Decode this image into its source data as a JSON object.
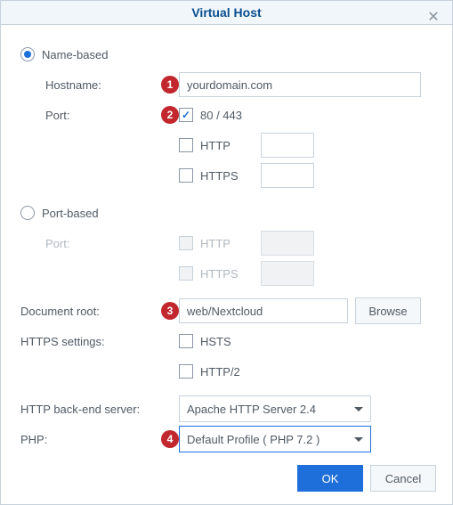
{
  "dialog": {
    "title": "Virtual Host"
  },
  "radio": {
    "name_based": "Name-based",
    "port_based": "Port-based"
  },
  "labels": {
    "hostname": "Hostname:",
    "port": "Port:",
    "docroot": "Document root:",
    "https_settings": "HTTPS settings:",
    "backend": "HTTP back-end server:",
    "php": "PHP:"
  },
  "fields": {
    "hostname_value": "yourdomain.com",
    "port_any_label": "80 / 443",
    "http_label": "HTTP",
    "https_label": "HTTPS",
    "docroot_value": "web/Nextcloud",
    "browse_btn": "Browse",
    "hsts_label": "HSTS",
    "http2_label": "HTTP/2",
    "backend_value": "Apache HTTP Server 2.4",
    "php_value": "Default Profile ( PHP 7.2 )"
  },
  "buttons": {
    "ok": "OK",
    "cancel": "Cancel"
  },
  "badges": {
    "b1": "1",
    "b2": "2",
    "b3": "3",
    "b4": "4"
  }
}
